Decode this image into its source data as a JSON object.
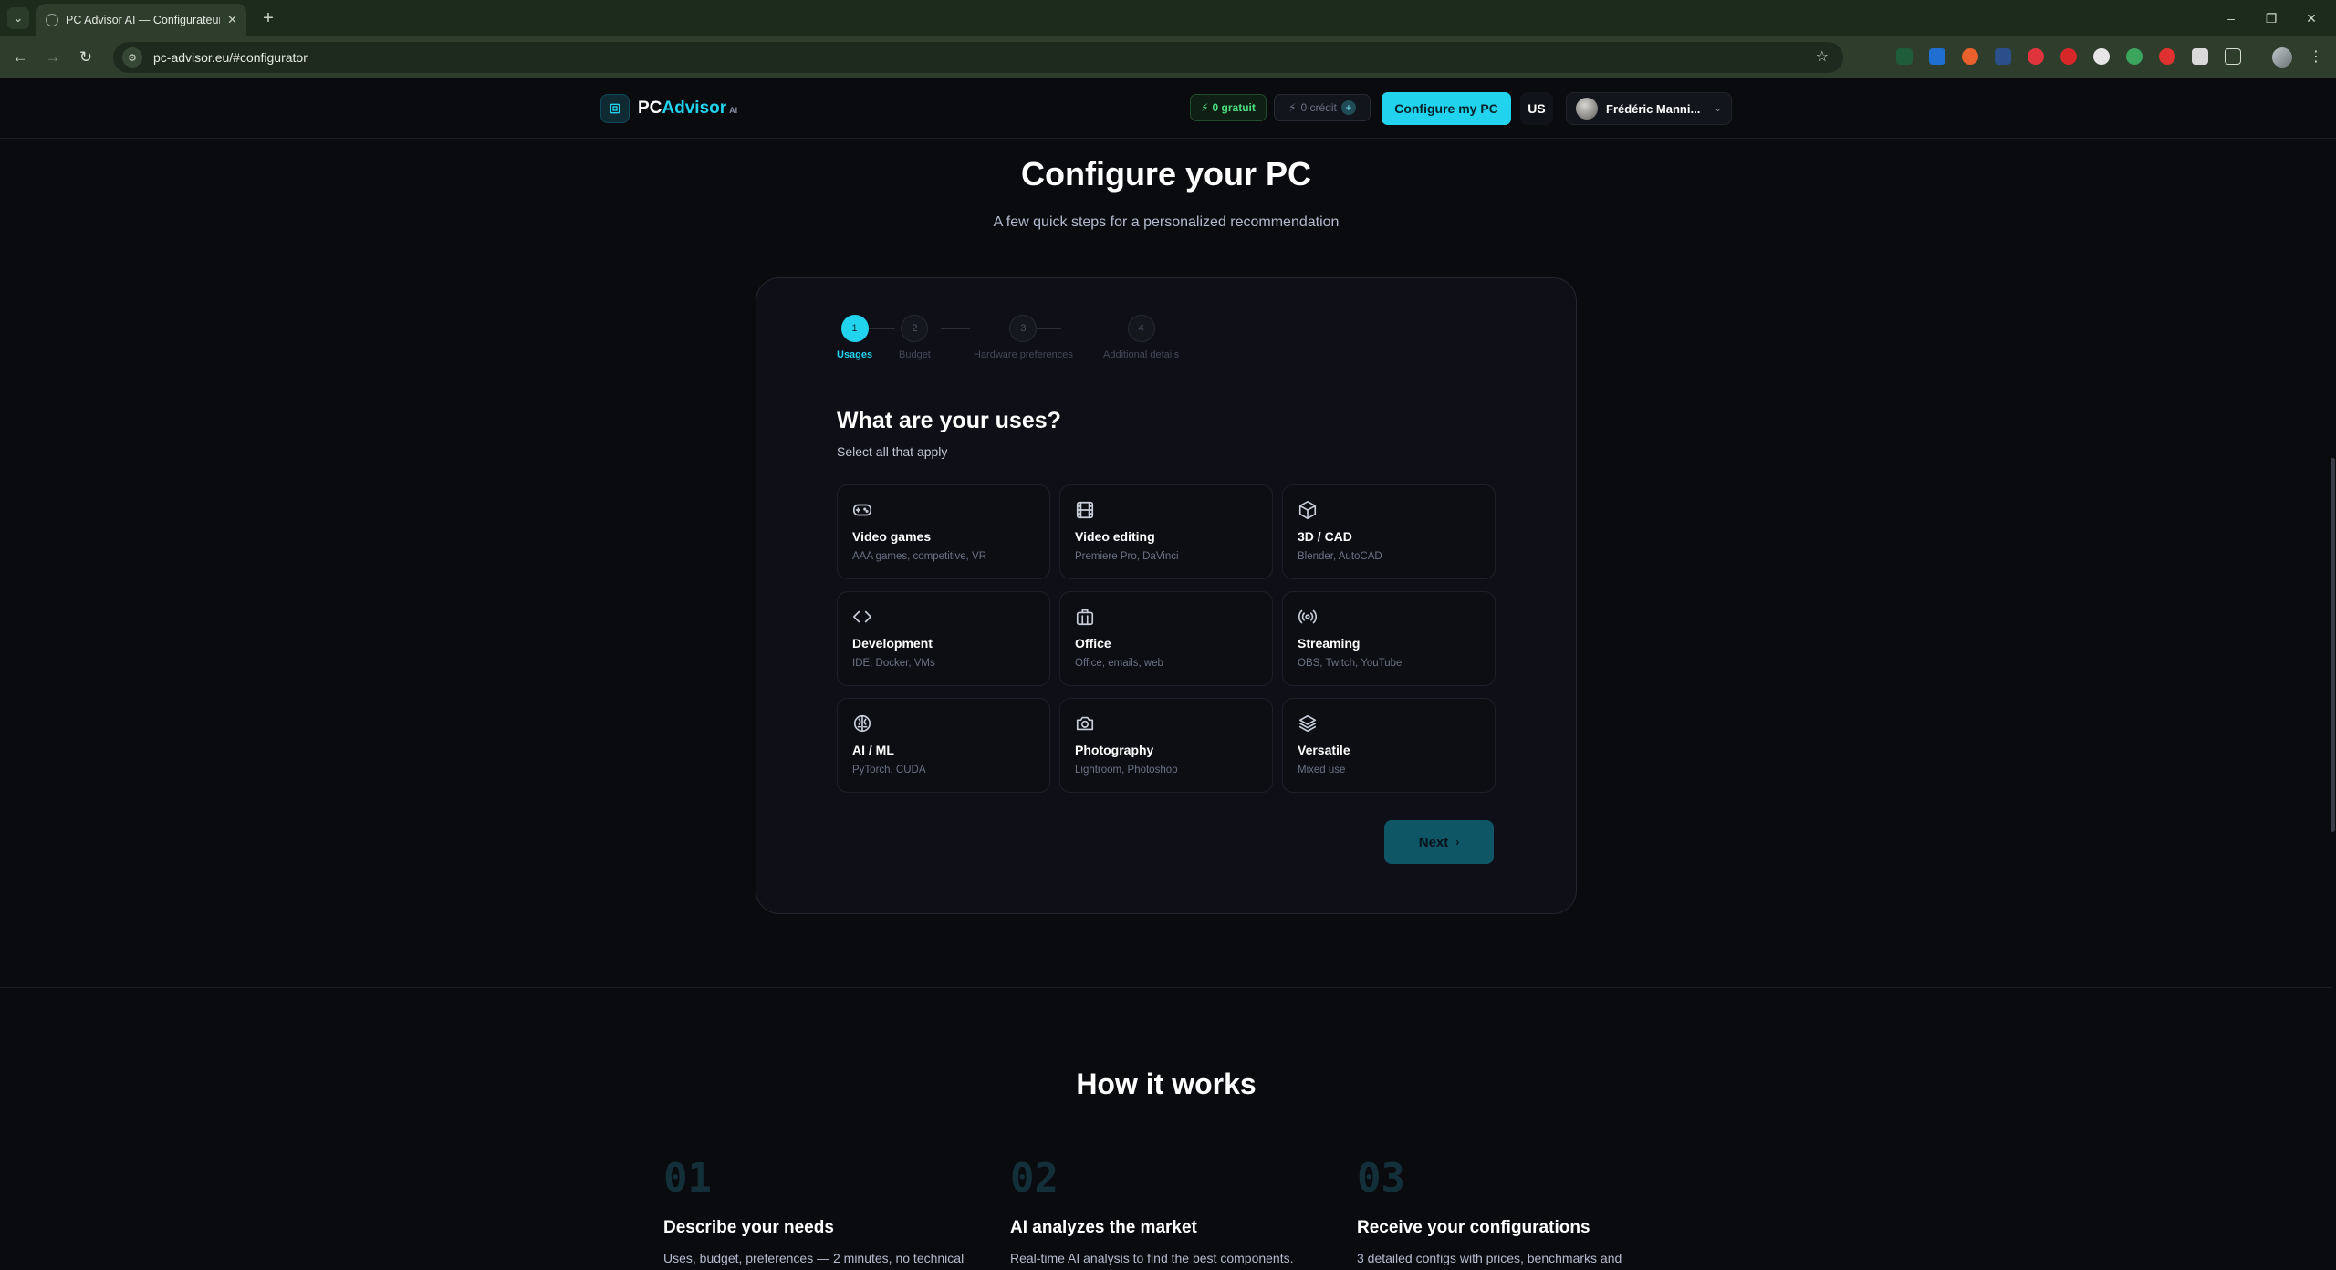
{
  "browser": {
    "tab_title": "PC Advisor AI — Configurateur",
    "url": "pc-advisor.eu/#configurator"
  },
  "header": {
    "logo_pc": "PC",
    "logo_advisor": "Advisor",
    "logo_ai": "AI",
    "free_badge": "0 gratuit",
    "credit_badge": "0 crédit",
    "configure_button": "Configure my PC",
    "language": "US",
    "user_name": "Frédéric Manni..."
  },
  "hero": {
    "title": "Configure your PC",
    "subtitle": "A few quick steps for a personalized recommendation"
  },
  "stepper": {
    "steps": [
      {
        "number": "1",
        "label": "Usages",
        "active": true
      },
      {
        "number": "2",
        "label": "Budget",
        "active": false
      },
      {
        "number": "3",
        "label": "Hardware preferences",
        "active": false
      },
      {
        "number": "4",
        "label": "Additional details",
        "active": false
      }
    ]
  },
  "question": {
    "title": "What are your uses?",
    "subtitle": "Select all that apply"
  },
  "options": [
    {
      "name": "Video games",
      "desc": "AAA games, competitive, VR",
      "icon": "gamepad-icon"
    },
    {
      "name": "Video editing",
      "desc": "Premiere Pro, DaVinci",
      "icon": "film-icon"
    },
    {
      "name": "3D / CAD",
      "desc": "Blender, AutoCAD",
      "icon": "cube-icon"
    },
    {
      "name": "Development",
      "desc": "IDE, Docker, VMs",
      "icon": "code-icon"
    },
    {
      "name": "Office",
      "desc": "Office, emails, web",
      "icon": "briefcase-icon"
    },
    {
      "name": "Streaming",
      "desc": "OBS, Twitch, YouTube",
      "icon": "broadcast-icon"
    },
    {
      "name": "AI / ML",
      "desc": "PyTorch, CUDA",
      "icon": "brain-icon"
    },
    {
      "name": "Photography",
      "desc": "Lightroom, Photoshop",
      "icon": "camera-icon"
    },
    {
      "name": "Versatile",
      "desc": "Mixed use",
      "icon": "layers-icon"
    }
  ],
  "next_button": "Next",
  "how_it_works": {
    "title": "How it works",
    "items": [
      {
        "num": "01",
        "title": "Describe your needs",
        "text": "Uses, budget, preferences — 2 minutes, no technical"
      },
      {
        "num": "02",
        "title": "AI analyzes the market",
        "text": "Real-time AI analysis to find the best components."
      },
      {
        "num": "03",
        "title": "Receive your configurations",
        "text": "3 detailed configs with prices, benchmarks and"
      }
    ]
  },
  "colors": {
    "accent": "#22d3ee",
    "background": "#0a0b0f",
    "card": "#0f1017",
    "free_green": "#4ade80"
  }
}
